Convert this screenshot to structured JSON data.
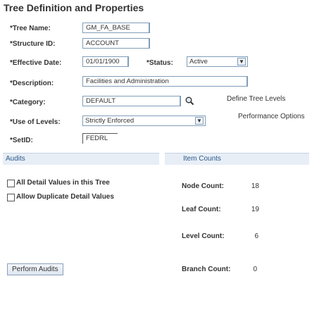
{
  "page": {
    "title": "Tree Definition and Properties"
  },
  "form": {
    "tree_name": {
      "label": "*Tree Name:",
      "value": "GM_FA_BASE"
    },
    "structure_id": {
      "label": "*Structure ID:",
      "value": "ACCOUNT"
    },
    "effective_date": {
      "label": "*Effective Date:",
      "value": "01/01/1900"
    },
    "status": {
      "label": "*Status:",
      "value": "Active"
    },
    "description": {
      "label": "*Description:",
      "value": "Facilities and Administration"
    },
    "category": {
      "label": "*Category:",
      "value": "DEFAULT"
    },
    "use_of_levels": {
      "label": "*Use of Levels:",
      "value": "Strictly Enforced"
    },
    "setid": {
      "label": "*SetID:",
      "value": "FEDRL"
    }
  },
  "links": {
    "define_tree_levels": "Define Tree Levels",
    "performance_options": "Performance Options"
  },
  "audits": {
    "header": "Audits",
    "all_detail_values": "All Detail Values in this Tree",
    "allow_duplicate": "Allow Duplicate Detail Values",
    "perform_audits_button": "Perform Audits"
  },
  "item_counts": {
    "header": "Item Counts",
    "node_count": {
      "label": "Node Count:",
      "value": "18"
    },
    "leaf_count": {
      "label": "Leaf Count:",
      "value": "19"
    },
    "level_count": {
      "label": "Level Count:",
      "value": "6"
    },
    "branch_count": {
      "label": "Branch Count:",
      "value": "0"
    }
  },
  "icons": {
    "lookup": "magnifier-lookup-icon",
    "dropdown": "chevron-down-icon"
  }
}
